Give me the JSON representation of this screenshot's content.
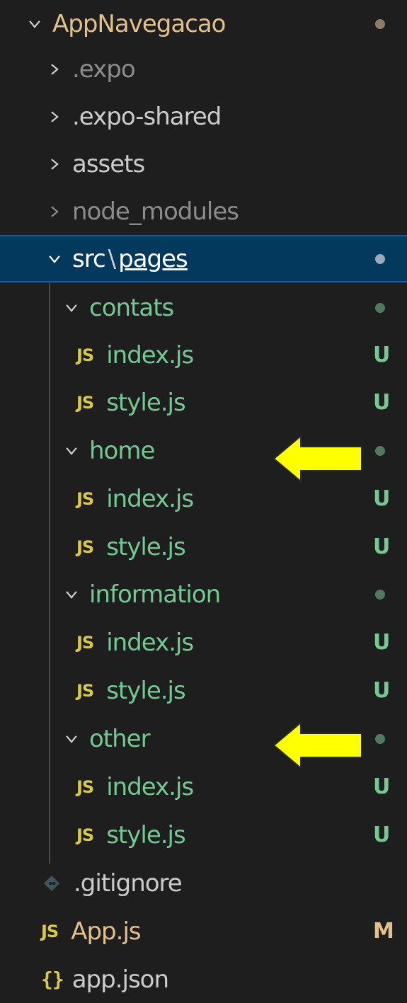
{
  "colors": {
    "background": "#1e1e1e",
    "selected_background": "#04395e",
    "untracked_green": "#73c991",
    "modified_tan": "#e2c08d",
    "default_text": "#cccccc",
    "ignored_text": "#8c8c8c",
    "arrow_yellow": "#ffff00"
  },
  "explorer": {
    "root": {
      "label": "AppNavegacao",
      "icon": "chevron-down-icon"
    },
    "folders": [
      {
        "label": ".expo",
        "icon": "chevron-right-icon"
      },
      {
        "label": ".expo-shared",
        "icon": "chevron-right-icon"
      },
      {
        "label": "assets",
        "icon": "chevron-right-icon"
      },
      {
        "label": "node_modules",
        "icon": "chevron-right-icon"
      }
    ],
    "selected_path": {
      "part1": "src",
      "separator": "\\",
      "part2": "pages",
      "icon": "chevron-down-icon"
    },
    "subfolders": [
      {
        "label": "contats",
        "files": [
          {
            "icon": "JS",
            "label": "index.js",
            "status": "U"
          },
          {
            "icon": "JS",
            "label": "style.js",
            "status": "U"
          }
        ]
      },
      {
        "label": "home",
        "files": [
          {
            "icon": "JS",
            "label": "index.js",
            "status": "U"
          },
          {
            "icon": "JS",
            "label": "style.js",
            "status": "U"
          }
        ]
      },
      {
        "label": "information",
        "files": [
          {
            "icon": "JS",
            "label": "index.js",
            "status": "U"
          },
          {
            "icon": "JS",
            "label": "style.js",
            "status": "U"
          }
        ]
      },
      {
        "label": "other",
        "files": [
          {
            "icon": "JS",
            "label": "index.js",
            "status": "U"
          },
          {
            "icon": "JS",
            "label": "style.js",
            "status": "U"
          }
        ]
      }
    ],
    "root_files": [
      {
        "icon": "git-icon",
        "label": ".gitignore",
        "status": ""
      },
      {
        "icon": "JS",
        "label": "App.js",
        "status": "M"
      },
      {
        "icon": "{}",
        "label": "app.json",
        "status": ""
      }
    ]
  },
  "annotations": [
    {
      "icon": "left-arrow-annotation",
      "points_to": "home"
    },
    {
      "icon": "left-arrow-annotation",
      "points_to": "other"
    }
  ]
}
